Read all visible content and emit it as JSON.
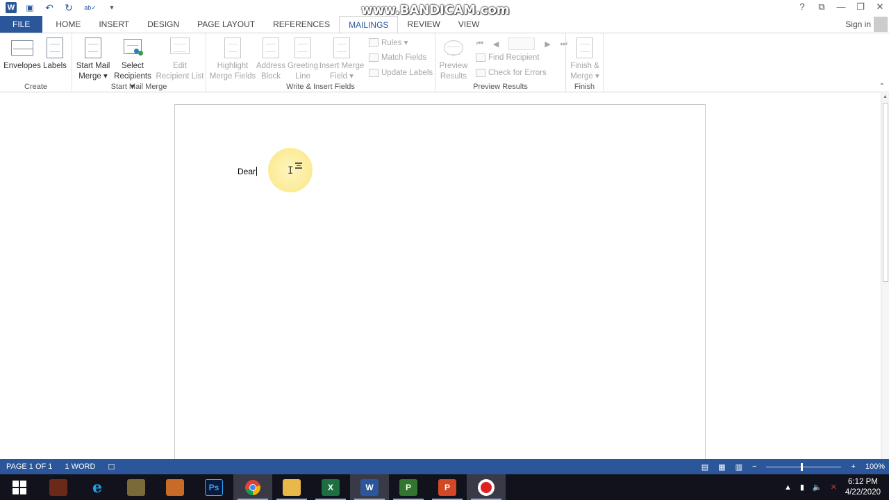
{
  "window": {
    "watermark": "www.BANDICAM.com",
    "help_glyph": "?",
    "restore_ribbon_glyph": "⧉",
    "minimize_glyph": "—",
    "maximize_glyph": "❐",
    "close_glyph": "✕"
  },
  "qat": {
    "word_glyph": "W",
    "save_glyph": "💾",
    "undo_glyph": "↶",
    "redo_glyph": "↻",
    "spell_glyph": "ab✓",
    "more_glyph": "▾"
  },
  "tabs": [
    "FILE",
    "HOME",
    "INSERT",
    "DESIGN",
    "PAGE LAYOUT",
    "REFERENCES",
    "MAILINGS",
    "REVIEW",
    "VIEW"
  ],
  "active_tab": "MAILINGS",
  "signin": "Sign in",
  "ribbon": {
    "create": {
      "label": "Create",
      "envelopes": "Envelopes",
      "labels": "Labels"
    },
    "start": {
      "label": "Start Mail Merge",
      "start_l1": "Start Mail",
      "start_l2": "Merge ▾",
      "select_l1": "Select",
      "select_l2": "Recipients ▾",
      "edit_l1": "Edit",
      "edit_l2": "Recipient List"
    },
    "write": {
      "label": "Write & Insert Fields",
      "highlight_l1": "Highlight",
      "highlight_l2": "Merge Fields",
      "address_l1": "Address",
      "address_l2": "Block",
      "greeting_l1": "Greeting",
      "greeting_l2": "Line",
      "insert_l1": "Insert Merge",
      "insert_l2": "Field ▾",
      "rules": "Rules ▾",
      "match": "Match Fields",
      "update": "Update Labels"
    },
    "preview": {
      "label": "Preview Results",
      "preview_l1": "Preview",
      "preview_l2": "Results",
      "find": "Find Recipient",
      "check": "Check for Errors",
      "first_glyph": "⏮",
      "prev_glyph": "◀",
      "next_glyph": "▶",
      "last_glyph": "⏭"
    },
    "finish": {
      "label": "Finish",
      "finish_l1": "Finish &",
      "finish_l2": "Merge ▾"
    },
    "collapse_glyph": "⌃"
  },
  "document": {
    "text": "Dear"
  },
  "status": {
    "page": "PAGE 1 OF 1",
    "words": "1 WORD",
    "zoom": "100%",
    "zoom_level_percent": 100,
    "minus": "−",
    "plus": "+"
  },
  "taskbar": {
    "ps": "Ps",
    "excel": "X",
    "word": "W",
    "project": "P",
    "powerpoint": "P",
    "time": "6:12 PM",
    "date": "4/22/2020"
  },
  "colors": {
    "accent": "#2b579a",
    "taskbar": "#12121c"
  }
}
